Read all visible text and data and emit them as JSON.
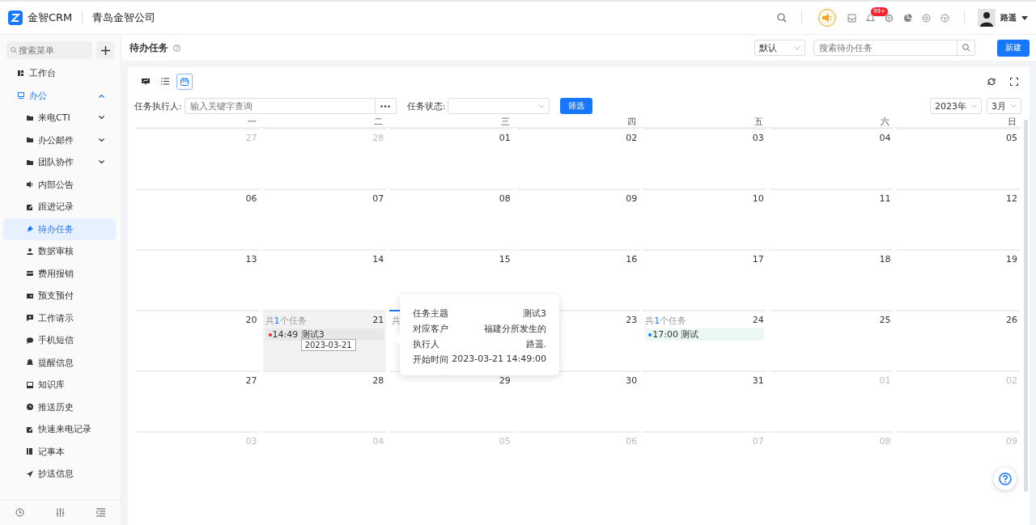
{
  "header": {
    "logo_text": "金智CRM",
    "company": "青岛金智公司",
    "notifications_badge": "99+",
    "user_name": "路遥"
  },
  "sidebar": {
    "search_placeholder": "搜索菜单",
    "items": [
      {
        "label": "工作台",
        "kind": "dashboard",
        "selected": false
      },
      {
        "label": "办公",
        "kind": "group",
        "expanded": true,
        "selected": false,
        "children": [
          {
            "label": "来电CTI",
            "kind": "folder",
            "expanded": false,
            "selected": false
          },
          {
            "label": "办公邮件",
            "kind": "folder",
            "expanded": false,
            "selected": false
          },
          {
            "label": "团队协作",
            "kind": "folder",
            "expanded": false,
            "selected": false
          },
          {
            "label": "内部公告",
            "kind": "speaker",
            "selected": false
          },
          {
            "label": "跟进记录",
            "kind": "edit",
            "selected": false
          },
          {
            "label": "待办任务",
            "kind": "pin",
            "selected": true
          },
          {
            "label": "数据审核",
            "kind": "user",
            "selected": false
          },
          {
            "label": "费用报销",
            "kind": "card",
            "selected": false
          },
          {
            "label": "预支预付",
            "kind": "wallet",
            "selected": false
          },
          {
            "label": "工作请示",
            "kind": "flag",
            "selected": false
          },
          {
            "label": "手机短信",
            "kind": "chat",
            "selected": false
          },
          {
            "label": "提醒信息",
            "kind": "bell",
            "selected": false
          },
          {
            "label": "知识库",
            "kind": "book",
            "selected": false
          },
          {
            "label": "推送历史",
            "kind": "clock",
            "selected": false
          },
          {
            "label": "快速来电记录",
            "kind": "edit",
            "selected": false
          },
          {
            "label": "记事本",
            "kind": "notebook",
            "selected": false
          },
          {
            "label": "抄送信息",
            "kind": "send",
            "selected": false
          }
        ]
      }
    ]
  },
  "page": {
    "title": "待办任务",
    "view_select": "默认",
    "search_placeholder": "搜索待办任务",
    "new_button": "新建"
  },
  "toolbar": {
    "views": [
      {
        "kind": "board",
        "selected": false
      },
      {
        "kind": "list",
        "selected": false
      },
      {
        "kind": "calendar",
        "selected": true
      }
    ]
  },
  "filters": {
    "assignee_label": "任务执行人:",
    "assignee_placeholder": "输入关键字查询",
    "status_label": "任务状态:",
    "filter_button": "筛选"
  },
  "calendar": {
    "year": "2023年",
    "month": "3月",
    "weekdays": [
      "一",
      "二",
      "三",
      "四",
      "五",
      "六",
      "日"
    ],
    "weeks": [
      [
        {
          "day": "27",
          "in_month": false
        },
        {
          "day": "28",
          "in_month": false
        },
        {
          "day": "01",
          "in_month": true
        },
        {
          "day": "02",
          "in_month": true
        },
        {
          "day": "03",
          "in_month": true
        },
        {
          "day": "04",
          "in_month": true
        },
        {
          "day": "05",
          "in_month": true
        }
      ],
      [
        {
          "day": "06",
          "in_month": true
        },
        {
          "day": "07",
          "in_month": true
        },
        {
          "day": "08",
          "in_month": true
        },
        {
          "day": "09",
          "in_month": true
        },
        {
          "day": "10",
          "in_month": true
        },
        {
          "day": "11",
          "in_month": true
        },
        {
          "day": "12",
          "in_month": true
        }
      ],
      [
        {
          "day": "13",
          "in_month": true
        },
        {
          "day": "14",
          "in_month": true
        },
        {
          "day": "15",
          "in_month": true
        },
        {
          "day": "16",
          "in_month": true
        },
        {
          "day": "17",
          "in_month": true
        },
        {
          "day": "18",
          "in_month": true
        },
        {
          "day": "19",
          "in_month": true
        }
      ],
      [
        {
          "day": "20",
          "in_month": true
        },
        {
          "day": "21",
          "in_month": true,
          "hovered": true,
          "summary": {
            "prefix": "共",
            "count": "1",
            "suffix": "个任务"
          },
          "events": [
            {
              "time": "14:49",
              "title": "测试3",
              "color": "#f5222d",
              "tooltip": "2023-03-21"
            }
          ]
        },
        {
          "in_month": true,
          "today": true,
          "summary": {
            "prefix": "共"
          }
        },
        {
          "day": "23",
          "in_month": true
        },
        {
          "day": "24",
          "in_month": true,
          "summary": {
            "prefix": "共",
            "count": "1",
            "suffix": "个任务"
          },
          "events": [
            {
              "time": "17:00",
              "title": "测试",
              "color": "#1677ff"
            }
          ]
        },
        {
          "day": "25",
          "in_month": true
        },
        {
          "day": "26",
          "in_month": true
        }
      ],
      [
        {
          "day": "27",
          "in_month": true
        },
        {
          "day": "28",
          "in_month": true
        },
        {
          "day": "29",
          "in_month": true
        },
        {
          "day": "30",
          "in_month": true
        },
        {
          "day": "31",
          "in_month": true
        },
        {
          "day": "01",
          "in_month": false
        },
        {
          "day": "02",
          "in_month": false
        }
      ],
      [
        {
          "day": "03",
          "in_month": false
        },
        {
          "day": "04",
          "in_month": false
        },
        {
          "day": "05",
          "in_month": false
        },
        {
          "day": "06",
          "in_month": false
        },
        {
          "day": "07",
          "in_month": false
        },
        {
          "day": "08",
          "in_month": false
        },
        {
          "day": "09",
          "in_month": false
        }
      ]
    ],
    "popover": {
      "rows": [
        {
          "label": "任务主题",
          "value": "测试3"
        },
        {
          "label": "对应客户",
          "value": "福建分所发生的"
        },
        {
          "label": "执行人",
          "value": "路遥."
        },
        {
          "label": "开始时间",
          "value": "2023-03-21 14:49:00"
        }
      ]
    }
  }
}
